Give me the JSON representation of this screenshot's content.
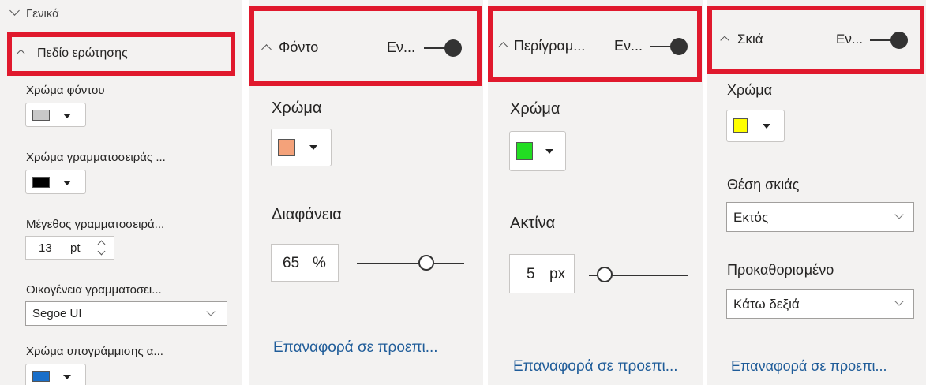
{
  "panel1": {
    "general_label": "Γενικά",
    "section_title": "Πεδίο ερώτησης",
    "bg_color_label": "Χρώμα φόντου",
    "bg_color": "#c8c8c8",
    "font_color_label": "Χρώμα γραμματοσειράς ...",
    "font_color": "#000000",
    "font_size_label": "Μέγεθος γραμματοσειρά...",
    "font_size_value": "13",
    "font_size_unit": "pt",
    "font_family_label": "Οικογένεια γραμματοσει...",
    "font_family_value": "Segoe UI",
    "underline_color_label": "Χρώμα υπογράμμισης α...",
    "underline_color": "#1a6fc9"
  },
  "panel2": {
    "title": "Φόντο",
    "toggle_label": "Εν...",
    "color_label": "Χρώμα",
    "color": "#f4a27a",
    "transparency_label": "Διαφάνεια",
    "transparency_value": "65",
    "transparency_unit": "%",
    "transparency_level": 65,
    "reset_link": "Επαναφορά σε προεπι..."
  },
  "panel3": {
    "title": "Περίγραμ...",
    "toggle_label": "Εν...",
    "color_label": "Χρώμα",
    "color": "#22dd22",
    "radius_label": "Ακτίνα",
    "radius_value": "5",
    "radius_unit": "px",
    "reset_link": "Επαναφορά σε προεπι..."
  },
  "panel4": {
    "title": "Σκιά",
    "toggle_label": "Εν...",
    "color_label": "Χρώμα",
    "color": "#ffff00",
    "position_label": "Θέση σκιάς",
    "position_value": "Εκτός",
    "preset_label": "Προκαθορισμένο",
    "preset_value": "Κάτω δεξιά",
    "reset_link": "Επαναφορά σε προεπι..."
  },
  "colors": {
    "highlight": "#e0192d",
    "link": "#1f5c99",
    "panel_bg": "#f3f2f1"
  }
}
